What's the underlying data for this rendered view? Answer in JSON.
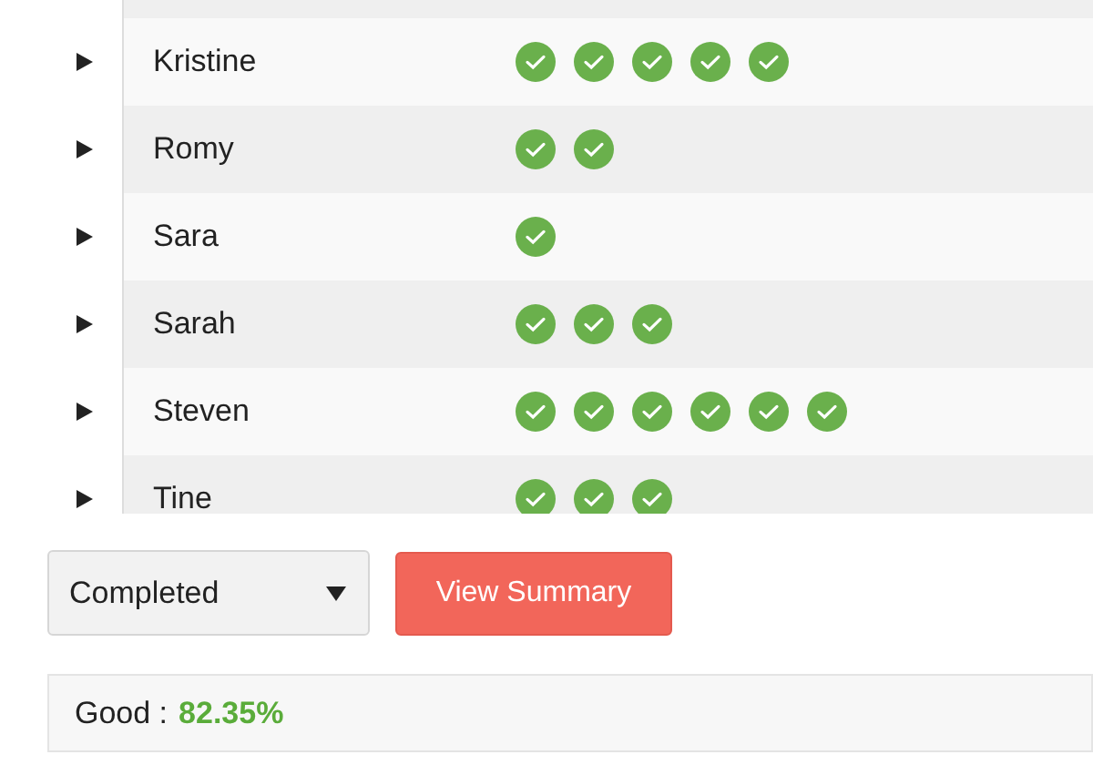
{
  "table": {
    "rows": [
      {
        "name": "Kristine",
        "expanded": false,
        "marks": [
          {
            "checked": true
          },
          {
            "checked": true
          },
          {
            "checked": true
          },
          {
            "checked": true
          },
          {
            "checked": true
          }
        ]
      },
      {
        "name": "Romy",
        "expanded": false,
        "marks": [
          {
            "checked": true
          },
          {
            "checked": true
          }
        ]
      },
      {
        "name": "Sara",
        "expanded": false,
        "marks": [
          {
            "checked": true
          }
        ]
      },
      {
        "name": "Sarah",
        "expanded": false,
        "marks": [
          {
            "checked": true
          },
          {
            "checked": true
          },
          {
            "checked": true
          }
        ]
      },
      {
        "name": "Steven",
        "expanded": false,
        "marks": [
          {
            "checked": true
          },
          {
            "checked": true
          },
          {
            "checked": true
          },
          {
            "checked": true
          },
          {
            "checked": true
          },
          {
            "checked": true
          }
        ]
      },
      {
        "name": "Tine",
        "expanded": false,
        "marks": [
          {
            "checked": true
          },
          {
            "checked": true
          },
          {
            "checked": true
          }
        ]
      }
    ]
  },
  "filter": {
    "value": "Completed"
  },
  "button": "View Summary",
  "result": {
    "label": "Good :",
    "value": "82.35%"
  }
}
